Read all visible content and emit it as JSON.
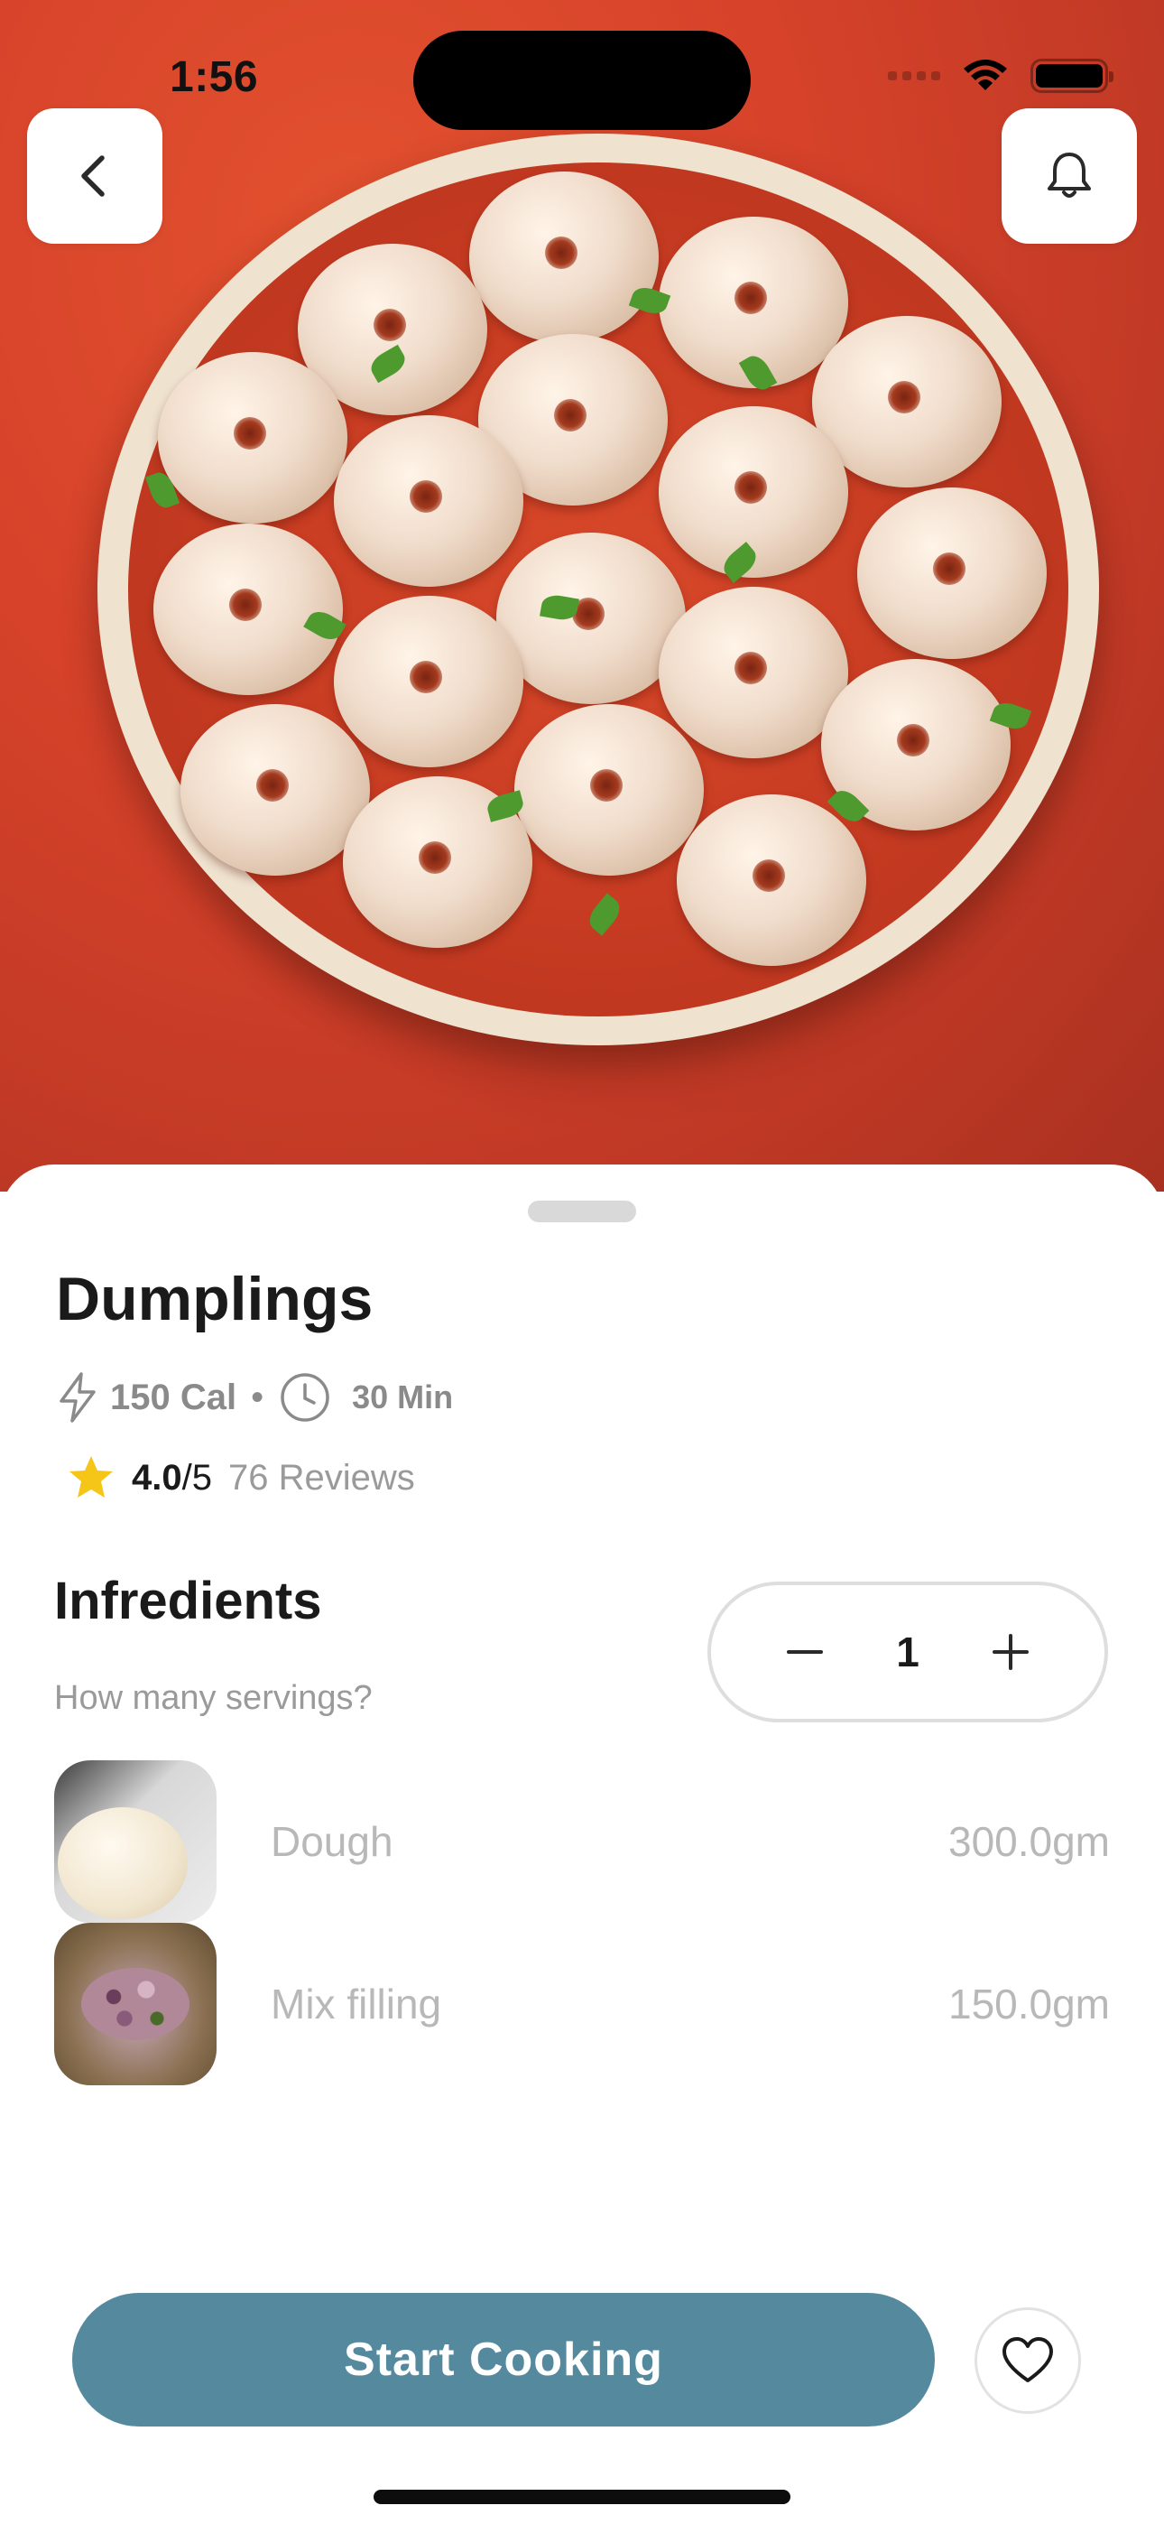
{
  "status_bar": {
    "time": "1:56"
  },
  "hero": {
    "image_alt": "Dumplings in red sauce",
    "icons": {
      "back": "chevron-left-icon",
      "notifications": "bell-icon"
    }
  },
  "recipe": {
    "title": "Dumplings",
    "calories": "150 Cal",
    "separator": "•",
    "time": "30 Min",
    "rating_value": "4.0",
    "rating_max": "/5",
    "reviews": "76 Reviews"
  },
  "ingredients_section": {
    "title": "Infredients",
    "servings_question": "How many servings?",
    "servings": "1",
    "items": [
      {
        "name": "Dough",
        "amount": "300.0gm"
      },
      {
        "name": "Mix filling",
        "amount": "150.0gm"
      }
    ]
  },
  "actions": {
    "start_cooking": "Start Cooking"
  },
  "colors": {
    "accent": "#558a9e",
    "star": "#f5c518",
    "hero_red": "#d6422a"
  }
}
